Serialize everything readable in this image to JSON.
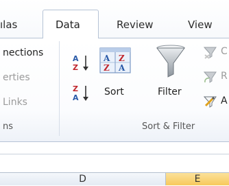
{
  "tabs": {
    "formulas_partial": "ılas",
    "data": "Data",
    "review": "Review",
    "view": "View"
  },
  "connections_group": {
    "connections_partial": "nections",
    "properties_partial": "erties",
    "edit_links_partial": "Links",
    "group_label_partial": "ns"
  },
  "sort_filter_group": {
    "sort_az_icon": "sort-ascending-icon",
    "sort_za_icon": "sort-descending-icon",
    "sort_icon": "sort-dialog-icon",
    "sort_label": "Sort",
    "filter_icon": "funnel-icon",
    "filter_label": "Filter",
    "clear_icon": "clear-filter-icon",
    "clear_partial": "C",
    "reapply_icon": "reapply-filter-icon",
    "reapply_partial": "R",
    "advanced_icon": "advanced-filter-icon",
    "advanced_partial": "A",
    "group_label": "Sort & Filter"
  },
  "columns": {
    "d": "D",
    "e": "E"
  },
  "colors": {
    "accent_blue": "#2a5aa8",
    "accent_red": "#c0262d",
    "selected_column": "#f7c95c"
  }
}
